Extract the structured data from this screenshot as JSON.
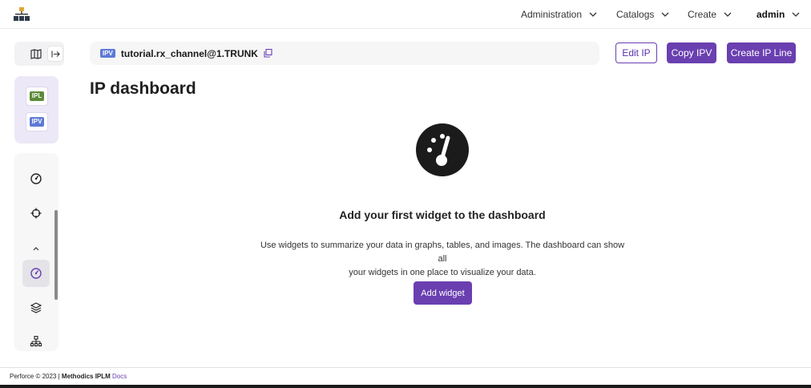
{
  "nav": {
    "items": [
      {
        "label": "Administration"
      },
      {
        "label": "Catalogs"
      },
      {
        "label": "Create"
      },
      {
        "label": "admin"
      }
    ]
  },
  "sidebar": {
    "tags": [
      "IPL",
      "IPV"
    ],
    "icons": [
      "dashboard-icon",
      "target-icon",
      "chevron-up-icon",
      "dashboard-active-icon",
      "layers-icon",
      "hierarchy-icon"
    ]
  },
  "breadcrumb": {
    "tag": "IPV",
    "path": "tutorial.rx_channel@1.TRUNK"
  },
  "actions": {
    "edit_ip": "Edit IP",
    "copy_ipv": "Copy IPV",
    "create_ip_line": "Create IP Line"
  },
  "page": {
    "title": "IP dashboard"
  },
  "empty_state": {
    "title": "Add your first widget to the dashboard",
    "description_line1": "Use widgets to summarize your data in graphs, tables, and images. The dashboard can show all",
    "description_line2": "your widgets in one place to visualize your data.",
    "button": "Add widget"
  },
  "footer": {
    "copyright": "Perforce © 2023 | ",
    "brand": "Methodics IPLM",
    "docs": "Docs"
  },
  "colors": {
    "accent": "#6a3fb0",
    "ipl_tag": "#5c8a3a",
    "ipv_tag": "#5d7ad6"
  }
}
